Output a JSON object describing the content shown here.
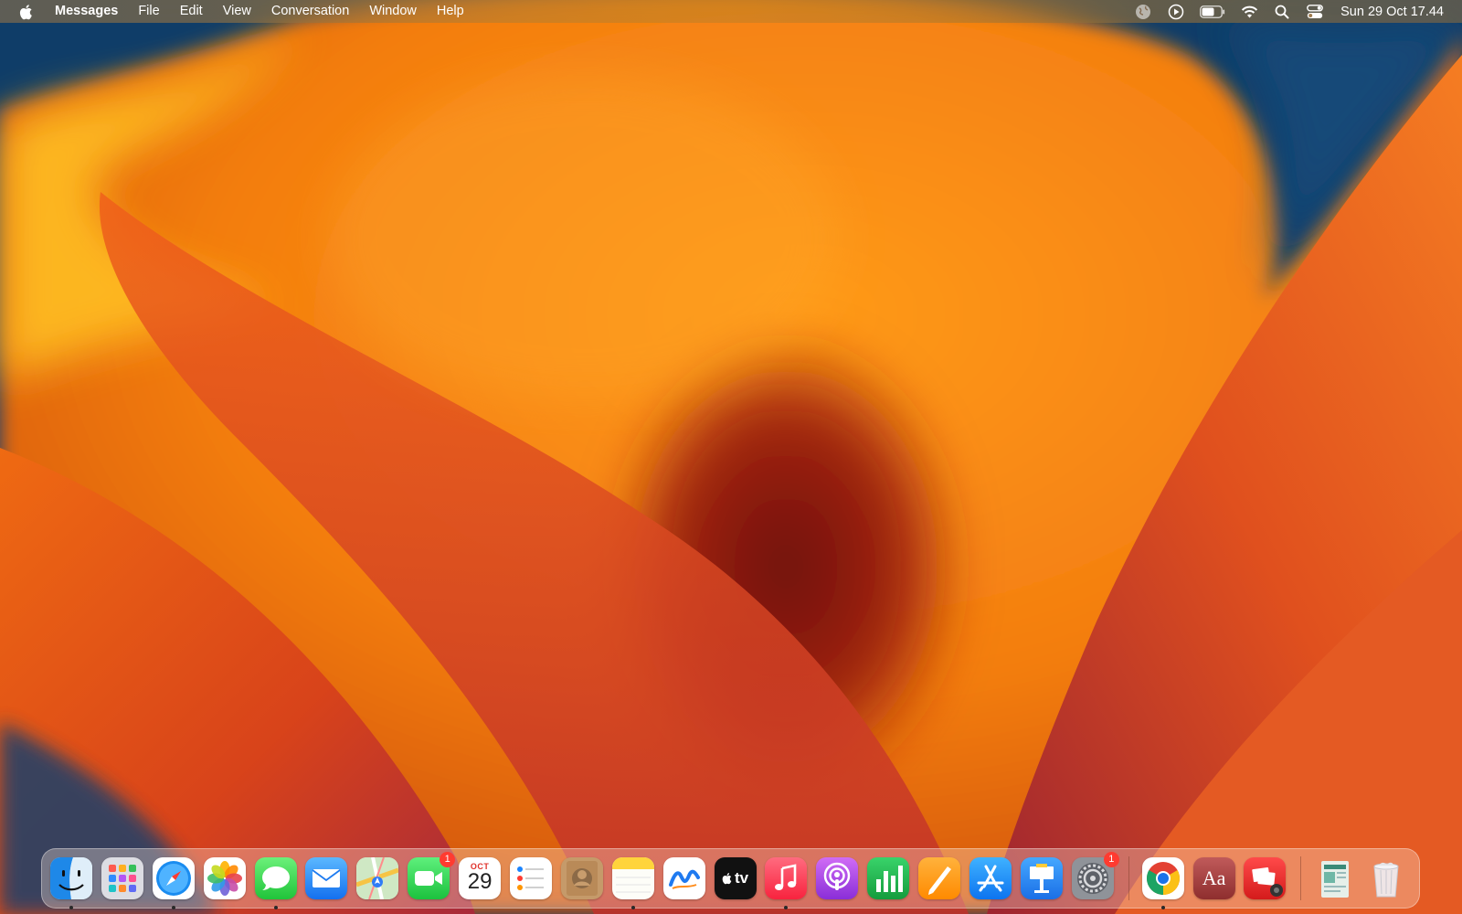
{
  "menubar": {
    "apple_icon": "apple-logo-icon",
    "app_name": "Messages",
    "menus": [
      "File",
      "Edit",
      "View",
      "Conversation",
      "Window",
      "Help"
    ],
    "status_icons": [
      "globe-icon",
      "play-circle-icon",
      "battery-icon",
      "wifi-icon",
      "search-icon",
      "control-center-icon"
    ],
    "clock": "Sun 29 Oct  17.44"
  },
  "dock": {
    "apps": [
      {
        "name": "Finder",
        "icon": "finder-icon",
        "running": true
      },
      {
        "name": "Launchpad",
        "icon": "launchpad-icon",
        "running": false
      },
      {
        "name": "Safari",
        "icon": "safari-icon",
        "running": true
      },
      {
        "name": "Photos",
        "icon": "photos-icon",
        "running": false
      },
      {
        "name": "Messages",
        "icon": "messages-icon",
        "running": true
      },
      {
        "name": "Mail",
        "icon": "mail-icon",
        "running": false
      },
      {
        "name": "Maps",
        "icon": "maps-icon",
        "running": false
      },
      {
        "name": "FaceTime",
        "icon": "facetime-icon",
        "running": false,
        "badge": "1"
      },
      {
        "name": "Calendar",
        "icon": "calendar-icon",
        "running": false,
        "month": "OCT",
        "day": "29"
      },
      {
        "name": "Reminders",
        "icon": "reminders-icon",
        "running": false
      },
      {
        "name": "Contacts",
        "icon": "contacts-icon",
        "running": false
      },
      {
        "name": "Notes",
        "icon": "notes-icon",
        "running": true
      },
      {
        "name": "Freeform",
        "icon": "freeform-icon",
        "running": false
      },
      {
        "name": "TV",
        "icon": "apple-tv-icon",
        "running": false,
        "label": "tv"
      },
      {
        "name": "Music",
        "icon": "music-icon",
        "running": true
      },
      {
        "name": "Podcasts",
        "icon": "podcasts-icon",
        "running": false
      },
      {
        "name": "Numbers",
        "icon": "numbers-icon",
        "running": false
      },
      {
        "name": "Pages",
        "icon": "pages-icon",
        "running": false
      },
      {
        "name": "App Store",
        "icon": "app-store-icon",
        "running": false
      },
      {
        "name": "Keynote",
        "icon": "keynote-icon",
        "running": false
      },
      {
        "name": "System Settings",
        "icon": "system-settings-icon",
        "running": false,
        "badge": "1"
      }
    ],
    "apps2": [
      {
        "name": "Google Chrome",
        "icon": "chrome-icon",
        "running": true
      },
      {
        "name": "Dictionary",
        "icon": "dictionary-icon",
        "running": false,
        "label": "Aa"
      },
      {
        "name": "Photo Booth",
        "icon": "photo-booth-icon",
        "running": false
      }
    ],
    "stack": [
      {
        "name": "Downloads",
        "icon": "downloads-stack-icon"
      },
      {
        "name": "Trash",
        "icon": "trash-icon"
      }
    ]
  }
}
